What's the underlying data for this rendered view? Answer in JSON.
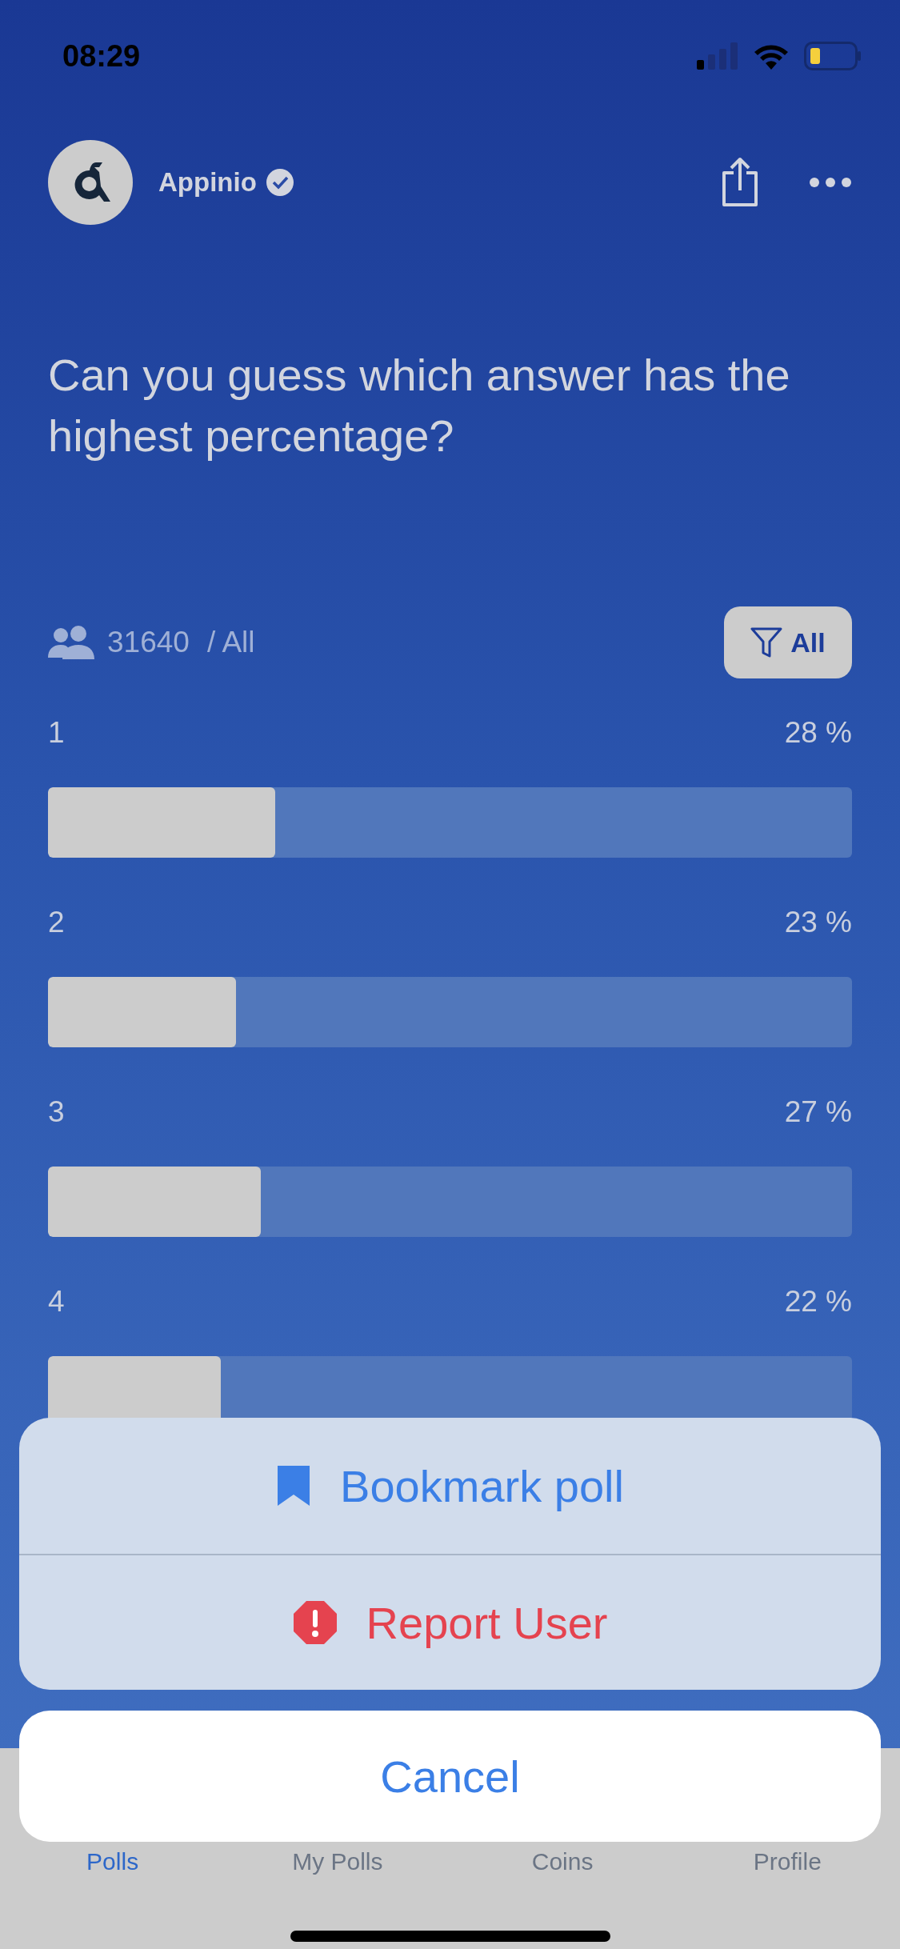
{
  "status_bar": {
    "time": "08:29"
  },
  "header": {
    "name": "Appinio"
  },
  "question": "Can you guess which answer has the highest percentage?",
  "stats": {
    "count": "31640",
    "scope": "/ All"
  },
  "filter_button": {
    "label": "All"
  },
  "options": [
    {
      "label": "1",
      "percent": "28 %",
      "level": 0.283
    },
    {
      "label": "2",
      "percent": "23 %",
      "level": 0.234
    },
    {
      "label": "3",
      "percent": "27 %",
      "level": 0.265
    },
    {
      "label": "4",
      "percent": "22 %",
      "level": 0.215
    }
  ],
  "action_sheet": {
    "actions": [
      {
        "kind": "bookmark",
        "label": "Bookmark poll"
      },
      {
        "kind": "report",
        "label": "Report User"
      }
    ],
    "cancel": "Cancel"
  },
  "tab_bar": [
    {
      "label": "Polls",
      "selected": true
    },
    {
      "label": "My Polls",
      "selected": false
    },
    {
      "label": "Coins",
      "selected": false
    },
    {
      "label": "Profile",
      "selected": false
    }
  ]
}
